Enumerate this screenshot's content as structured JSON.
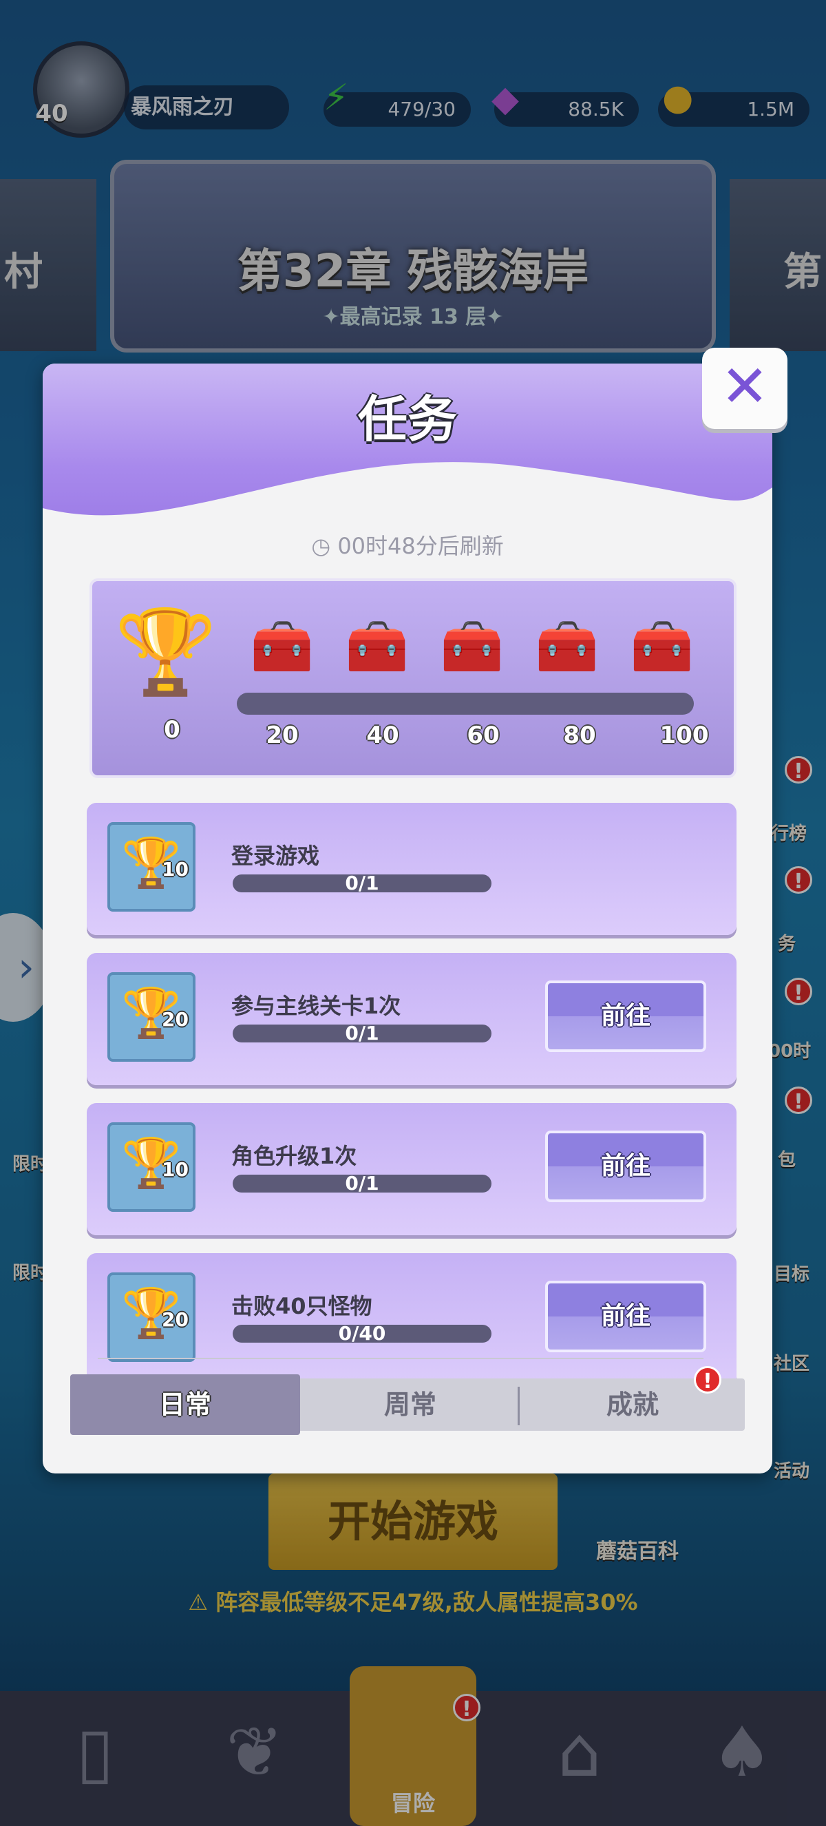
{
  "player": {
    "level": "40",
    "name": "暴风雨之刃"
  },
  "resources": {
    "energy": {
      "value": "479/30",
      "icon": "lightning-icon"
    },
    "gems": {
      "value": "88.5K",
      "icon": "gem-icon"
    },
    "coins": {
      "value": "1.5M",
      "icon": "coin-icon"
    }
  },
  "chapter": {
    "title": "第32章 残骸海岸",
    "record": "✦最高记录 13 层✦",
    "prev_side": "村",
    "next_side": "第"
  },
  "side_menu": {
    "right": [
      "行榜",
      "务",
      "00时",
      "包",
      "目标",
      "社区",
      "活动"
    ],
    "left": [
      "限时",
      "限时"
    ]
  },
  "modal": {
    "title": "任务",
    "close_label": "✕",
    "refresh_text": "00时48分后刷新",
    "reward": {
      "current_points": "0",
      "milestones": [
        "20",
        "40",
        "60",
        "80",
        "100"
      ],
      "progress": 0
    },
    "tasks": [
      {
        "name": "登录游戏",
        "progress": "0/1",
        "points": "10",
        "action": ""
      },
      {
        "name": "参与主线关卡1次",
        "progress": "0/1",
        "points": "20",
        "action": "前往"
      },
      {
        "name": "角色升级1次",
        "progress": "0/1",
        "points": "10",
        "action": "前往"
      },
      {
        "name": "击败40只怪物",
        "progress": "0/40",
        "points": "20",
        "action": "前往"
      }
    ],
    "tabs": [
      {
        "label": "日常",
        "active": true
      },
      {
        "label": "周常",
        "active": false
      },
      {
        "label": "成就",
        "active": false,
        "alert": "!"
      }
    ]
  },
  "bottom": {
    "start_label": "开始游戏",
    "encyclopedia_label": "蘑菇百科",
    "warning": "阵容最低等级不足47级,敌人属性提高30%",
    "nav_active_label": "冒险"
  }
}
